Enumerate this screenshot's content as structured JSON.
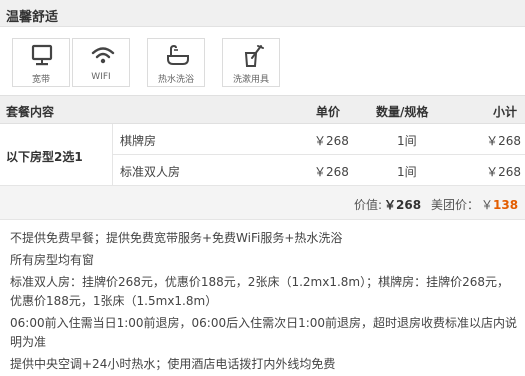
{
  "section": {
    "title": "温馨舒适"
  },
  "amenities": [
    {
      "icon": "monitor-icon",
      "label": "宽带"
    },
    {
      "icon": "wifi-icon",
      "label": "WIFI"
    },
    {
      "icon": "bathtub-icon",
      "label": "热水洗浴"
    },
    {
      "icon": "toiletries-icon",
      "label": "洗漱用具"
    }
  ],
  "table": {
    "headers": {
      "package": "套餐内容",
      "price": "单价",
      "qty": "数量/规格",
      "subtotal": "小计"
    },
    "combo_label": "以下房型2选1",
    "rows": [
      {
        "name": "棋牌房",
        "price": "￥268",
        "qty": "1间",
        "subtotal": "￥268"
      },
      {
        "name": "标准双人房",
        "price": "￥268",
        "qty": "1间",
        "subtotal": "￥268"
      }
    ]
  },
  "summary": {
    "price_label": "价值:",
    "price_value": "￥268",
    "group_label": "美团价：",
    "group_currency": "￥",
    "group_value": "138"
  },
  "notes": [
    "不提供免费早餐；提供免费宽带服务+免费WiFi服务+热水洗浴",
    "所有房型均有窗",
    "标准双人房：挂牌价268元，优惠价188元，2张床（1.2mx1.8m）；棋牌房：挂牌价268元，优惠价188元，1张床（1.5mx1.8m）",
    "06:00前入住需当日1:00前退房，06:00后入住需次日1:00前退房，超时退房收费标准以店内说明为准",
    "提供中央空调+24小时热水；使用酒店电话拨打内外线均免费"
  ],
  "colors": {
    "accent_price": "#e35d00",
    "header_bg": "#efefef"
  }
}
